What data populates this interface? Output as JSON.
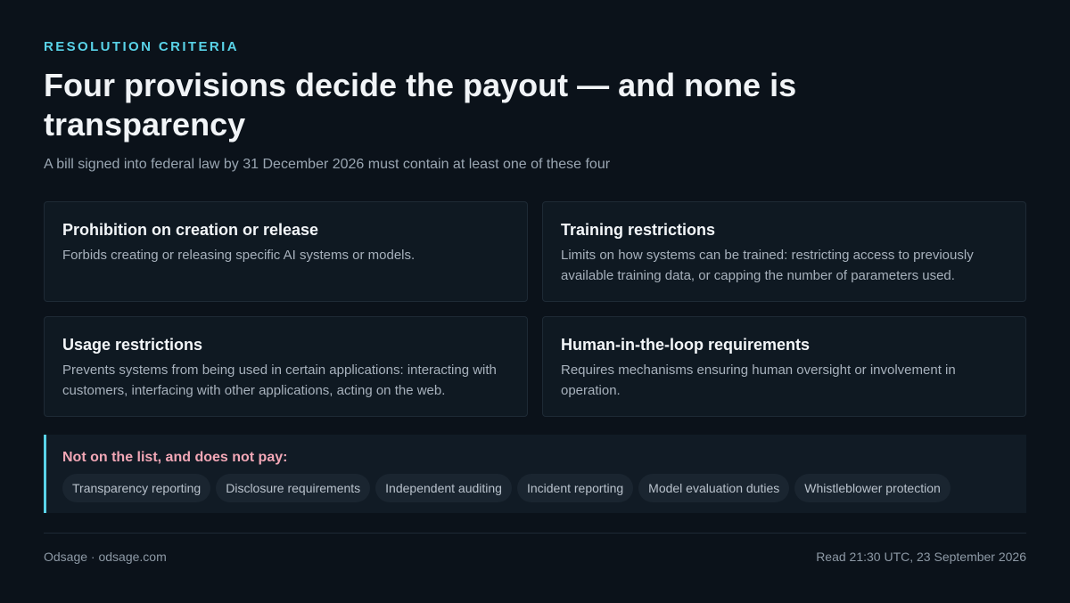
{
  "header": {
    "eyebrow": "RESOLUTION CRITERIA",
    "title": "Four provisions decide the payout — and none is transparency",
    "subtitle": "A bill signed into federal law by 31 December 2026 must contain at least one of these four"
  },
  "provisions": [
    {
      "title": "Prohibition on creation or release",
      "body": "Forbids creating or releasing specific AI systems or models."
    },
    {
      "title": "Training restrictions",
      "body": "Limits on how systems can be trained: restricting access to previously available training data, or capping the number of parameters used."
    },
    {
      "title": "Usage restrictions",
      "body": "Prevents systems from being used in certain applications: interacting with customers, interfacing with other applications, acting on the web."
    },
    {
      "title": "Human-in-the-loop requirements",
      "body": "Requires mechanisms ensuring human oversight or involvement in operation."
    }
  ],
  "excluded": {
    "title": "Not on the list, and does not pay:",
    "items": [
      "Transparency reporting",
      "Disclosure requirements",
      "Independent auditing",
      "Incident reporting",
      "Model evaluation duties",
      "Whistleblower protection"
    ]
  },
  "footer": {
    "source": "Odsage · odsage.com",
    "timestamp": "Read 21:30 UTC, 23 September 2026"
  },
  "colors": {
    "background": "#0b121a",
    "accent": "#59d3e8",
    "warning": "#f2a7b6"
  }
}
